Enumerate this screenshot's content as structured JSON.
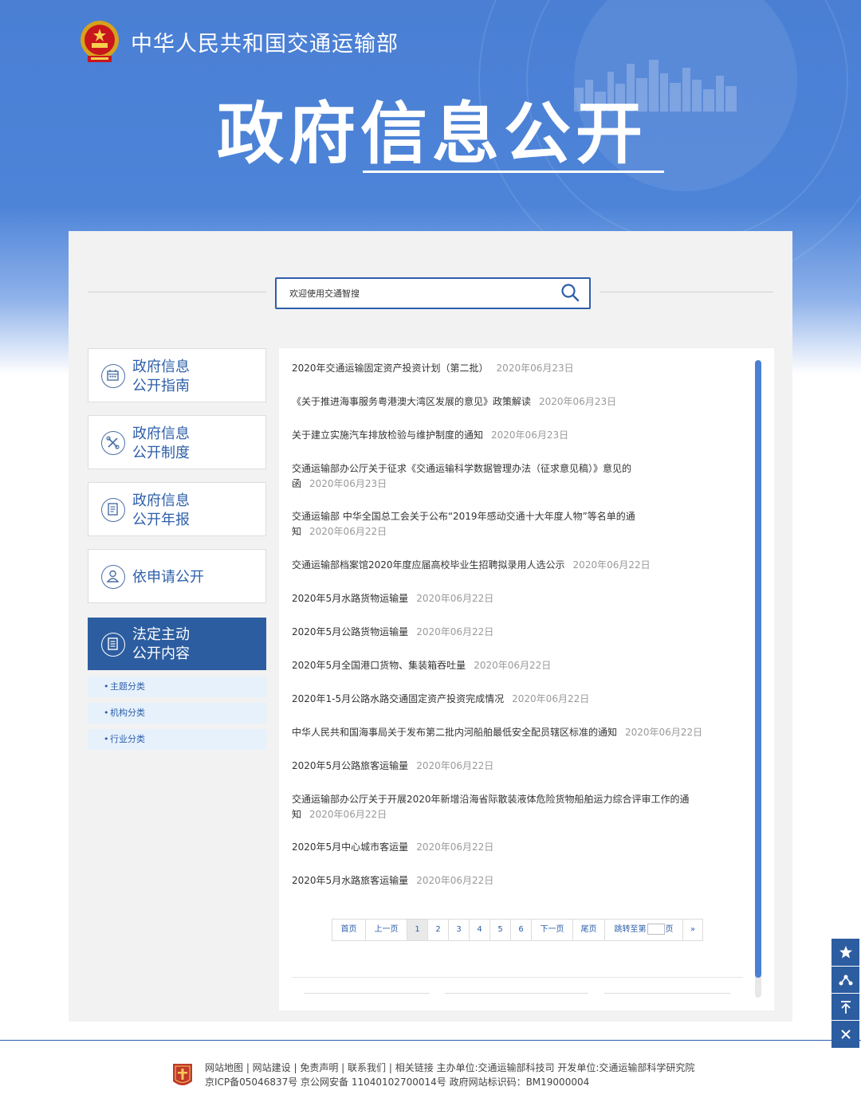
{
  "header": {
    "ministry_name": "中华人民共和国交通运输部",
    "page_title": "政府信息公开"
  },
  "search": {
    "placeholder": "欢迎使用交通智搜"
  },
  "sidebar": {
    "items": [
      {
        "label_line1": "政府信息",
        "label_line2": "公开指南",
        "icon": "calendar-icon"
      },
      {
        "label_line1": "政府信息",
        "label_line2": "公开制度",
        "icon": "tools-icon"
      },
      {
        "label_line1": "政府信息",
        "label_line2": "公开年报",
        "icon": "report-icon"
      },
      {
        "label": "依申请公开",
        "icon": "user-icon"
      },
      {
        "label_line1": "法定主动",
        "label_line2": "公开内容",
        "icon": "document-icon",
        "active": true
      }
    ],
    "sub_items": [
      "主题分类",
      "机构分类",
      "行业分类"
    ]
  },
  "news": [
    {
      "title": "2020年交通运输固定资产投资计划（第二批）",
      "date": "2020年06月23日"
    },
    {
      "title": "《关于推进海事服务粤港澳大湾区发展的意见》政策解读",
      "date": "2020年06月23日"
    },
    {
      "title": "关于建立实施汽车排放检验与维护制度的通知",
      "date": "2020年06月23日"
    },
    {
      "title_line1": "交通运输部办公厅关于征求《交通运输科学数据管理办法（征求意见稿）》意见的",
      "title_line2": "函",
      "date": "2020年06月23日"
    },
    {
      "title_line1": "交通运输部 中华全国总工会关于公布“2019年感动交通十大年度人物”等名单的通",
      "title_line2": "知",
      "date": "2020年06月22日"
    },
    {
      "title": "交通运输部档案馆2020年度应届高校毕业生招聘拟录用人选公示",
      "date": "2020年06月22日"
    },
    {
      "title": "2020年5月水路货物运输量",
      "date": "2020年06月22日"
    },
    {
      "title": "2020年5月公路货物运输量",
      "date": "2020年06月22日"
    },
    {
      "title": "2020年5月全国港口货物、集装箱吞吐量",
      "date": "2020年06月22日"
    },
    {
      "title": "2020年1-5月公路水路交通固定资产投资完成情况",
      "date": "2020年06月22日"
    },
    {
      "title": "中华人民共和国海事局关于发布第二批内河船舶最低安全配员辖区标准的通知",
      "date": "2020年06月22日"
    },
    {
      "title": "2020年5月公路旅客运输量",
      "date": "2020年06月22日"
    },
    {
      "title_line1": "交通运输部办公厅关于开展2020年新增沿海省际散装液体危险货物船舶运力综合评审工作的通",
      "title_line2": "知",
      "date": "2020年06月22日"
    },
    {
      "title": "2020年5月中心城市客运量",
      "date": "2020年06月22日"
    },
    {
      "title": "2020年5月水路旅客运输量",
      "date": "2020年06月22日"
    }
  ],
  "pagination": {
    "first": "首页",
    "prev": "上一页",
    "pages": [
      "1",
      "2",
      "3",
      "4",
      "5",
      "6"
    ],
    "current": "1",
    "next": "下一页",
    "last": "尾页",
    "jump_prefix": "跳转至第",
    "jump_suffix": "页",
    "more": "»"
  },
  "footer": {
    "line1": "网站地图 | 网站建设 | 免责声明 | 联系我们 | 相关链接 主办单位:交通运输部科技司 开发单位:交通运输部科学研究院",
    "line2": "京ICP备05046837号  京公网安备  11040102700014号  政府网站标识码：BM19000004"
  },
  "float_tools": [
    "star-icon",
    "share-icon",
    "back-to-top-icon",
    "close-icon"
  ],
  "colors": {
    "primary": "#2c5da0",
    "banner": "#4a7fd4",
    "date": "#999999"
  }
}
